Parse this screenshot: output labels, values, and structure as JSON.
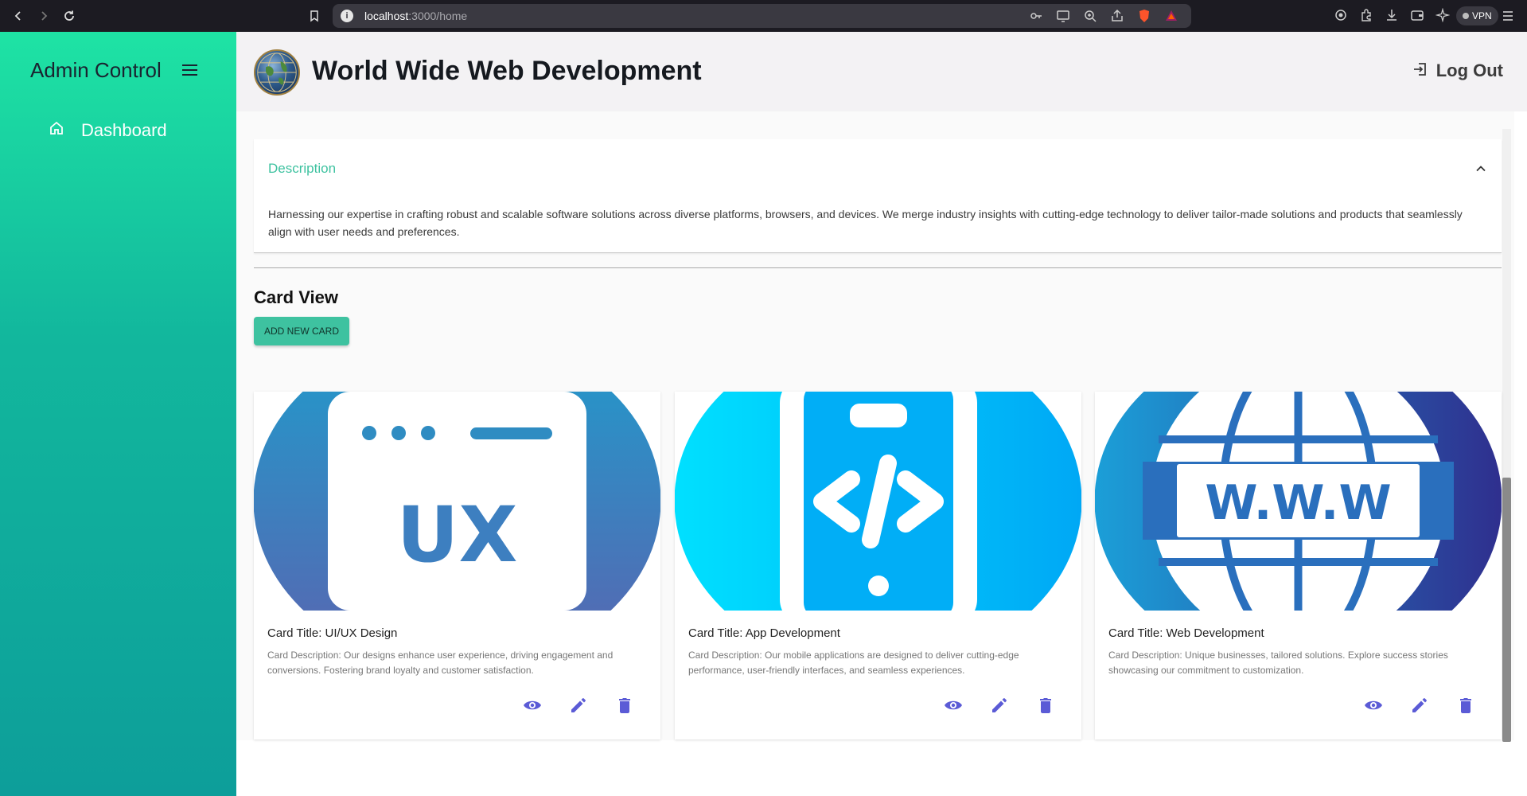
{
  "browser": {
    "url_host": "localhost",
    "url_path": ":3000/home",
    "vpn_label": "VPN"
  },
  "sidebar": {
    "title": "Admin Control",
    "items": [
      {
        "label": "Dashboard",
        "icon": "home-icon"
      }
    ]
  },
  "header": {
    "title": "World Wide Web Development",
    "logout_label": "Log Out"
  },
  "description": {
    "title": "Description",
    "body": "Harnessing our expertise in crafting robust and scalable software solutions across diverse platforms, browsers, and devices. We merge industry insights with cutting-edge technology to deliver tailor-made solutions and products that seamlessly align with user needs and preferences."
  },
  "card_view": {
    "title": "Card View",
    "add_button": "ADD NEW CARD",
    "cards": [
      {
        "title": "Card Title: UI/UX Design",
        "description": "Card Description: Our designs enhance user experience, driving engagement and conversions. Fostering brand loyalty and customer satisfaction.",
        "image_icon": "ux-window-icon",
        "image_text": "UX"
      },
      {
        "title": "Card Title: App Development",
        "description": "Card Description: Our mobile applications are designed to deliver cutting-edge performance, user-friendly interfaces, and seamless experiences.",
        "image_icon": "mobile-code-icon"
      },
      {
        "title": "Card Title: Web Development",
        "description": "Card Description: Unique businesses, tailored solutions. Explore success stories showcasing our commitment to customization.",
        "image_icon": "globe-www-icon",
        "image_text": "W.W.W"
      }
    ]
  },
  "colors": {
    "accent": "#3ec2a0",
    "action_icons": "#5b5bd6",
    "sidebar_top": "#1ee3a4",
    "sidebar_bottom": "#0d9e9a"
  }
}
